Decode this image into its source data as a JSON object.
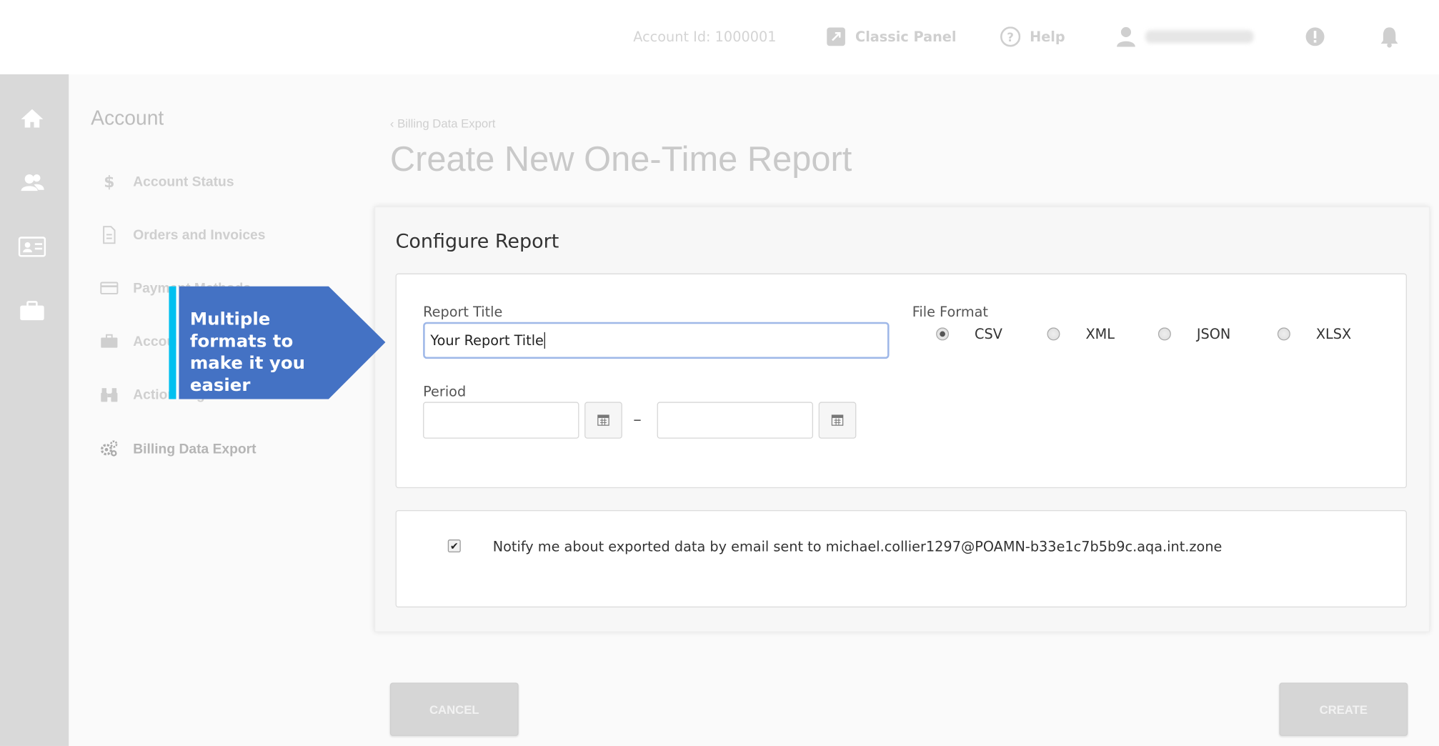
{
  "topbar": {
    "account_id": "Account Id: 1000001",
    "classic_panel": "Classic Panel",
    "help": "Help"
  },
  "sidebar": {
    "title": "Account",
    "items": [
      {
        "label": "Account Status",
        "icon": "dollar-icon"
      },
      {
        "label": "Orders and Invoices",
        "icon": "document-icon"
      },
      {
        "label": "Payment Methods",
        "icon": "card-icon"
      },
      {
        "label": "Account",
        "icon": "briefcase-icon"
      },
      {
        "label": "Action Log",
        "icon": "binoculars-icon"
      },
      {
        "label": "Billing Data Export",
        "icon": "gears-icon"
      }
    ]
  },
  "main": {
    "breadcrumb": "‹ Billing Data Export",
    "page_title": "Create New One-Time Report",
    "panel_title": "Configure Report",
    "report_title_label": "Report Title",
    "report_title_value": "Your Report Title",
    "period_label": "Period",
    "period_separator": "–",
    "file_format_label": "File Format",
    "formats": [
      {
        "label": "CSV",
        "checked": true
      },
      {
        "label": "XML",
        "checked": false
      },
      {
        "label": "JSON",
        "checked": false
      },
      {
        "label": "XLSX",
        "checked": false
      }
    ],
    "notify_text": "Notify me about exported data by email sent to michael.collier1297@POAMN-b33e1c7b5b9c.aqa.int.zone",
    "notify_checked": true,
    "cancel_label": "CANCEL",
    "create_label": "CREATE"
  },
  "callout": {
    "text": "Multiple formats to make it you easier"
  },
  "colors": {
    "callout_fill": "#4472c4",
    "callout_accent": "#00c0f0",
    "input_focus": "#9fb8e8",
    "rail": "#d9d9d9"
  }
}
